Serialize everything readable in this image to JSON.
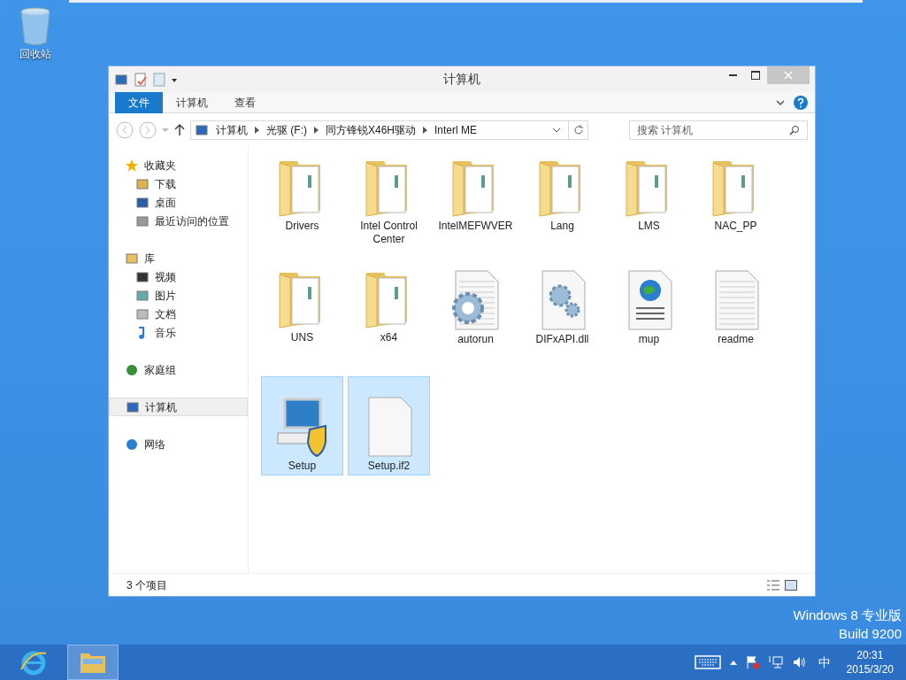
{
  "desktop": {
    "icons": [
      {
        "label": "回收站"
      }
    ],
    "watermark_lines": [
      "Windows 8 专业版",
      "Build 9200"
    ]
  },
  "window": {
    "title": "计算机",
    "ribbon_tabs": [
      {
        "label": "文件",
        "selected": true
      },
      {
        "label": "计算机",
        "selected": false
      },
      {
        "label": "查看",
        "selected": false
      }
    ],
    "address": {
      "crumbs": [
        "计算机",
        "光驱 (F:)",
        "同方锋锐X46H驱动",
        "Interl ME"
      ]
    },
    "search": {
      "placeholder": "搜索 计算机"
    },
    "sidebar": {
      "groups": [
        {
          "label": "收藏夹",
          "selected": false,
          "children": [
            {
              "label": "下载"
            },
            {
              "label": "桌面"
            },
            {
              "label": "最近访问的位置"
            }
          ]
        },
        {
          "label": "库",
          "selected": false,
          "children": [
            {
              "label": "视频"
            },
            {
              "label": "图片"
            },
            {
              "label": "文档"
            },
            {
              "label": "音乐"
            }
          ]
        },
        {
          "label": "家庭组",
          "selected": false
        },
        {
          "label": "计算机",
          "selected": true
        },
        {
          "label": "网络",
          "selected": false
        }
      ]
    },
    "files": [
      {
        "name": "Drivers",
        "kind": "folder",
        "selected": false
      },
      {
        "name": "Intel Control Center",
        "kind": "folder",
        "selected": false
      },
      {
        "name": "IntelMEFWVER",
        "kind": "folder",
        "selected": false
      },
      {
        "name": "Lang",
        "kind": "folder",
        "selected": false
      },
      {
        "name": "LMS",
        "kind": "folder",
        "selected": false
      },
      {
        "name": "NAC_PP",
        "kind": "folder",
        "selected": false
      },
      {
        "name": "UNS",
        "kind": "folder",
        "selected": false
      },
      {
        "name": "x64",
        "kind": "folder",
        "selected": false
      },
      {
        "name": "autorun",
        "kind": "config",
        "selected": false
      },
      {
        "name": "DIFxAPI.dll",
        "kind": "dll",
        "selected": false
      },
      {
        "name": "mup",
        "kind": "web",
        "selected": false
      },
      {
        "name": "readme",
        "kind": "text",
        "selected": false
      },
      {
        "name": "Setup",
        "kind": "setup",
        "selected": true
      },
      {
        "name": "Setup.if2",
        "kind": "blank",
        "selected": true
      }
    ],
    "status_bar": {
      "count": "3 个项目"
    }
  },
  "taskbar": {
    "input_method": "中",
    "time": "20:31",
    "date": "2015/3/20"
  }
}
